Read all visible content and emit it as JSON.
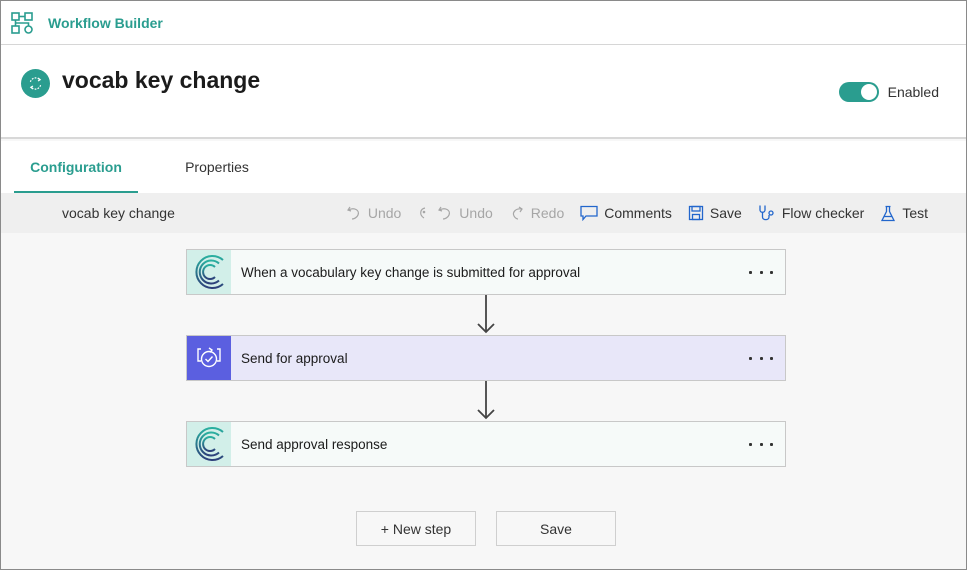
{
  "app": {
    "title": "Workflow Builder",
    "icon": "workflow-icon"
  },
  "header": {
    "flow_name": "vocab key change",
    "flow_icon": "refresh-circle-icon",
    "toggle": {
      "label": "Enabled",
      "on": true
    }
  },
  "tabs": [
    {
      "label": "Configuration",
      "active": true
    },
    {
      "label": "Properties",
      "active": false
    }
  ],
  "command_bar": {
    "breadcrumb": "vocab key change",
    "commands": [
      {
        "label": "Undo",
        "icon": "undo-icon",
        "enabled": false
      },
      {
        "label": "Undo",
        "icon": "undo-icon",
        "enabled": false
      },
      {
        "label": "Redo",
        "icon": "redo-icon",
        "enabled": false
      },
      {
        "label": "Comments",
        "icon": "comment-icon",
        "enabled": true
      },
      {
        "label": "Save",
        "icon": "save-icon",
        "enabled": true
      },
      {
        "label": "Flow checker",
        "icon": "stethoscope-icon",
        "enabled": true
      },
      {
        "label": "Test",
        "icon": "flask-icon",
        "enabled": true
      }
    ]
  },
  "steps": [
    {
      "label": "When a vocabulary key change is submitted for approval",
      "icon": "connector-c-icon"
    },
    {
      "label": "Send for approval",
      "icon": "approval-icon"
    },
    {
      "label": "Send approval response",
      "icon": "connector-c-icon"
    }
  ],
  "footer": {
    "new_step_label": "+ New step",
    "save_label": "Save"
  },
  "colors": {
    "accent": "#2a9d8f",
    "approval": "#5b5fe0",
    "command_icon": "#2266cc"
  }
}
